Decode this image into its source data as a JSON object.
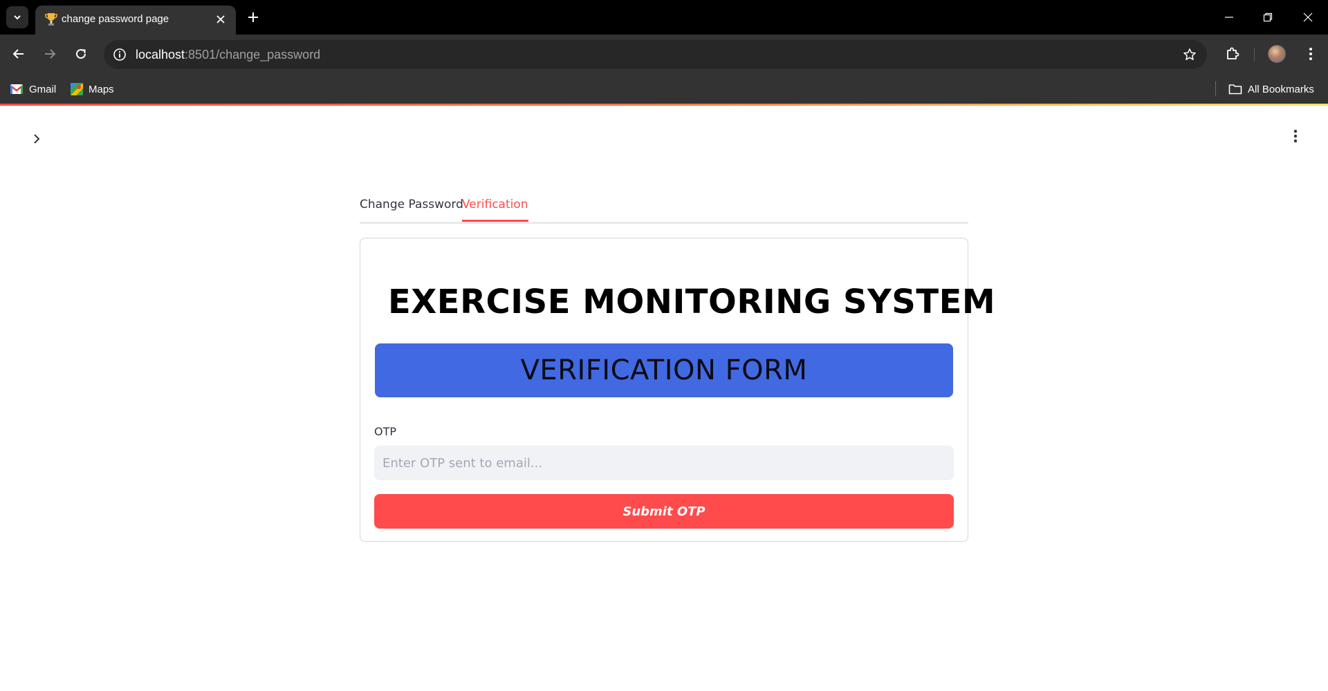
{
  "browser": {
    "tab_title": "change password page",
    "url_host": "localhost",
    "url_path": ":8501/change_password",
    "bookmarks": [
      {
        "label": "Gmail",
        "icon": "gmail-icon"
      },
      {
        "label": "Maps",
        "icon": "maps-icon"
      }
    ],
    "all_bookmarks_label": "All Bookmarks"
  },
  "app": {
    "tabs": [
      {
        "label": "Change Password",
        "active": false
      },
      {
        "label": "Verification",
        "active": true
      }
    ],
    "heading": "EXERCISE MONITORING SYSTEM",
    "banner": "VERIFICATION FORM",
    "otp_label": "OTP",
    "otp_value": "",
    "otp_placeholder": "Enter OTP sent to email...",
    "submit_label": "Submit OTP"
  },
  "colors": {
    "accent": "#ff4b4b",
    "banner": "#4169e1",
    "input_bg": "#f0f2f6"
  }
}
